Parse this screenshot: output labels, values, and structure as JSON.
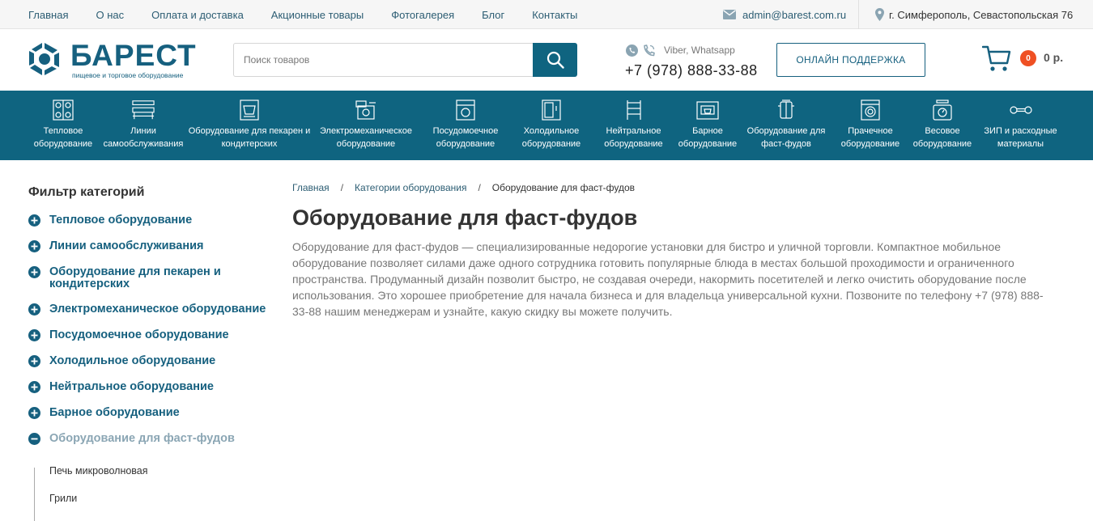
{
  "topbar": {
    "nav": [
      "Главная",
      "О нас",
      "Оплата и доставка",
      "Акционные товары",
      "Фотогалерея",
      "Блог",
      "Контакты"
    ],
    "email": "admin@barest.com.ru",
    "address": "г. Симферополь, Севастопольская 76"
  },
  "header": {
    "logo_text": "БАРЕСТ",
    "logo_sub": "пищевое и торговое оборудование",
    "search_placeholder": "Поиск товаров",
    "messengers": "Viber, Whatsapp",
    "phone": "+7 (978) 888-33-88",
    "support_label": "ОНЛАЙН ПОДДЕРЖКА",
    "cart_count": "0",
    "cart_sum": "0 р."
  },
  "categories": [
    {
      "label": "Тепловое\nоборудование",
      "icon": "stove-icon"
    },
    {
      "label": "Линии\nсамообслуживания",
      "icon": "serving-line-icon"
    },
    {
      "label": "Оборудование для пекарен и\nкондитерских",
      "icon": "mixer-icon"
    },
    {
      "label": "Электромеханическое\nоборудование",
      "icon": "meat-grinder-icon"
    },
    {
      "label": "Посудомоечное\nоборудование",
      "icon": "dishwasher-icon"
    },
    {
      "label": "Холодильное\nоборудование",
      "icon": "fridge-icon"
    },
    {
      "label": "Нейтральное\nоборудование",
      "icon": "rack-icon"
    },
    {
      "label": "Барное\nоборудование",
      "icon": "coffee-machine-icon"
    },
    {
      "label": "Оборудование для\nфаст-фудов",
      "icon": "fastfood-icon"
    },
    {
      "label": "Прачечное\nоборудование",
      "icon": "washing-machine-icon"
    },
    {
      "label": "Весовое\nоборудование",
      "icon": "scales-icon"
    },
    {
      "label": "ЗИП и расходные\nматериалы",
      "icon": "wrench-icon"
    }
  ],
  "sidebar": {
    "title": "Фильтр категорий",
    "items": [
      {
        "label": "Тепловое оборудование"
      },
      {
        "label": "Линии самообслуживания"
      },
      {
        "label": "Оборудование для пекарен и кондитерских"
      },
      {
        "label": "Электромеханическое оборудование"
      },
      {
        "label": "Посудомоечное оборудование"
      },
      {
        "label": "Холодильное оборудование"
      },
      {
        "label": "Нейтральное оборудование"
      },
      {
        "label": "Барное оборудование"
      },
      {
        "label": "Оборудование для фаст-фудов"
      }
    ],
    "subitems": [
      "Печь микроволновая",
      "Грили"
    ]
  },
  "breadcrumb": [
    "Главная",
    "Категории оборудования",
    "Оборудование для фаст-фудов"
  ],
  "breadcrumb_sep": "/",
  "main": {
    "title": "Оборудование для фаст-фудов",
    "description": "Оборудование для фаст-фудов — специализированные недорогие установки для бистро и уличной торговли. Компактное мобильное оборудование позволяет силами даже одного сотрудника готовить популярные блюда в местах большой проходимости и ограниченного пространства. Продуманный дизайн позволит быстро, не создавая очереди, накормить посетителей и легко очистить оборудование после использования. Это хорошее приобретение для начала бизнеса и для владельца универсальной кухни. Позвоните по телефону +7 (978) 888-33-88 нашим менеджерам и узнайте, какую скидку вы можете получить."
  },
  "colors": {
    "brand": "#16607f",
    "catbar": "#0f6480",
    "badge": "#ef5023"
  }
}
